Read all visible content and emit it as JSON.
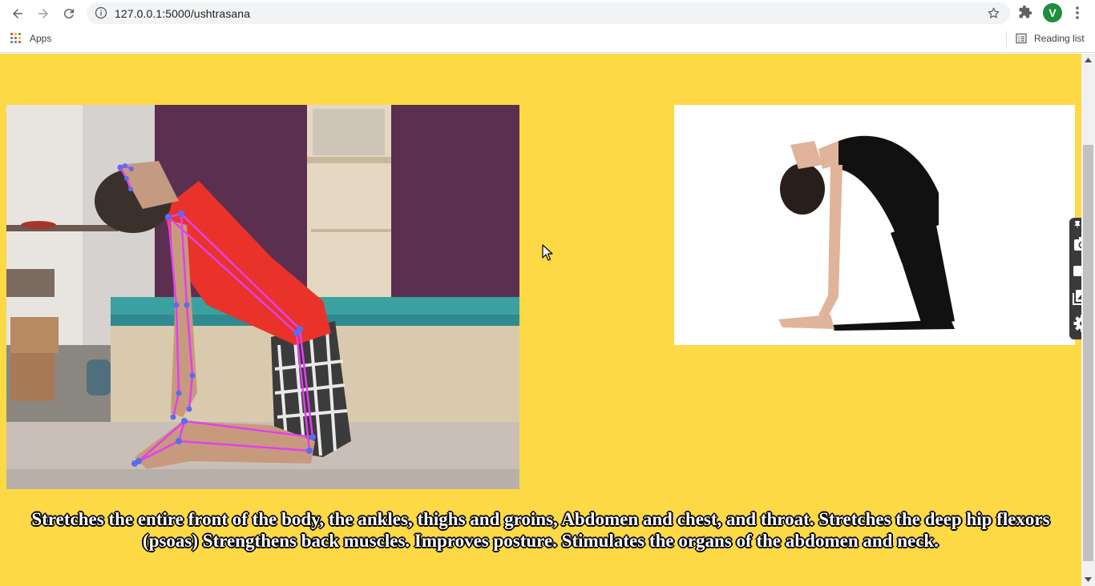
{
  "browser": {
    "url": "127.0.0.1:5000/ushtrasana",
    "profile_initial": "V",
    "bookmarks": {
      "apps_label": "Apps",
      "reading_list_label": "Reading list"
    },
    "icons": [
      "back-icon",
      "forward-icon",
      "reload-icon",
      "info-icon",
      "bookmark-star-icon",
      "extensions-icon",
      "menu-icon",
      "apps-grid-icon",
      "reading-list-icon"
    ]
  },
  "page": {
    "background_color": "#fcd945",
    "camera_feed": {
      "description_icon": "webcam-pose-feed",
      "skeleton_color": "#e040f0",
      "keypoint_color": "#5b6cf0"
    },
    "reference_image": {
      "icon": "ushtrasana-reference-pose"
    },
    "benefits_text": "Stretches the entire front of the body, the ankles, thighs and groins, Abdomen and chest, and throat. Stretches the deep hip flexors (psoas) Strengthens back muscles. Improves posture. Stimulates the organs of the abdomen and neck."
  },
  "floating_toolbar": {
    "tools": [
      "pin-icon",
      "camera-icon",
      "video-icon",
      "image-icon",
      "settings-icon"
    ]
  }
}
